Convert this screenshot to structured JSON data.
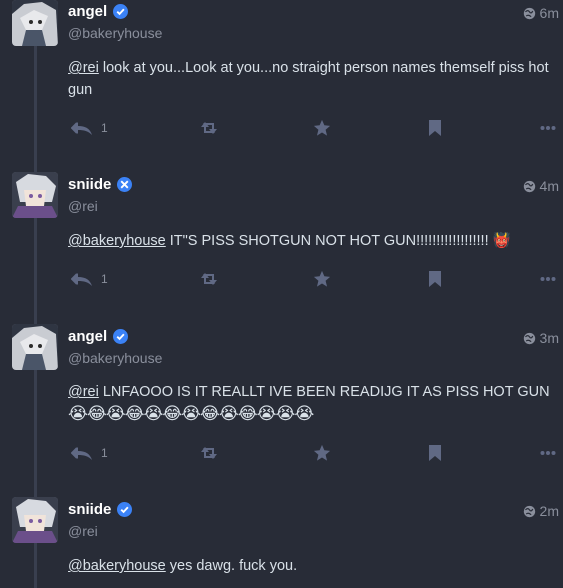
{
  "posts": [
    {
      "display_name": "angel",
      "handle": "@bakeryhouse",
      "time": "6m",
      "mention": "@rei",
      "text": " look at you...Look at you...no straight person names themself piss hot gun",
      "emoji_tail": "",
      "reply_count": "1",
      "avatar_color": "#9aa0a8"
    },
    {
      "display_name": "sniide",
      "handle": "@rei",
      "time": "4m",
      "mention": "@bakeryhouse",
      "text": " IT\"S PISS SHOTGUN NOT HOT GUN!!!!!!!!!!!!!!!!!!",
      "emoji_tail": "👹",
      "reply_count": "1",
      "avatar_color": "#7f8ba0"
    },
    {
      "display_name": "angel",
      "handle": "@bakeryhouse",
      "time": "3m",
      "mention": "@rei",
      "text": " LNFAOOO IS IT REALLT IVE BEEN READIJG IT AS PISS HOT GUN",
      "emoji_tail": "😭😂😭😂😭😂😭😂😭😂😭😭😭",
      "reply_count": "1",
      "avatar_color": "#9aa0a8"
    },
    {
      "display_name": "sniide",
      "handle": "@rei",
      "time": "2m",
      "mention": "@bakeryhouse",
      "text": " yes dawg. fuck you.",
      "emoji_tail": "",
      "reply_count": "",
      "avatar_color": "#7f8ba0"
    }
  ],
  "icons": {
    "verified": "verified-badge-icon",
    "globe": "globe-icon",
    "reply": "reply-all-icon",
    "boost": "boost-icon",
    "favourite": "star-icon",
    "bookmark": "bookmark-icon",
    "more": "more-icon"
  },
  "colors": {
    "background": "#282c37",
    "verified": "#3b82f6",
    "muted": "#606984"
  }
}
